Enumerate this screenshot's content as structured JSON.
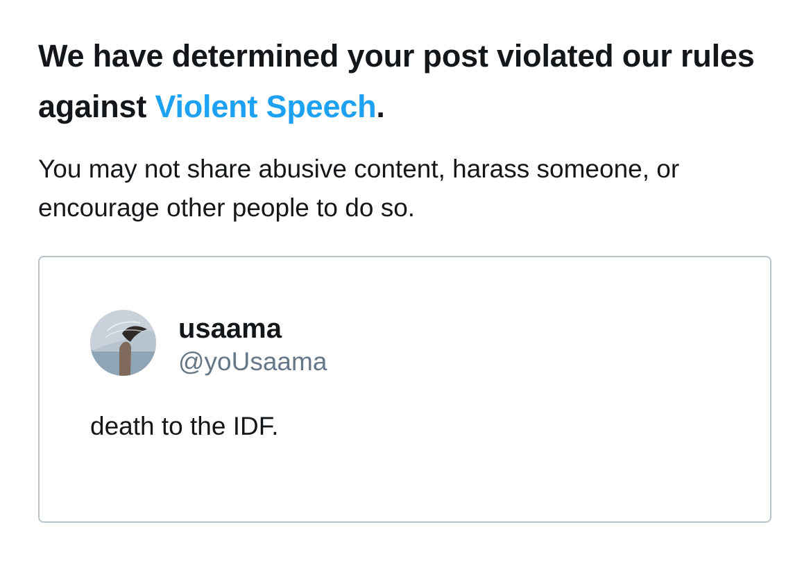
{
  "notice": {
    "headline_prefix": "We have determined your post violated our rules against ",
    "policy_link": "Violent Speech",
    "headline_suffix": ".",
    "subtext": "You may not share abusive content, harass someone, or encourage other people to do so."
  },
  "post": {
    "display_name": "usaama",
    "handle": "@yoUsaama",
    "text": "death to the IDF."
  },
  "colors": {
    "text": "#14171a",
    "link": "#1da1f2",
    "secondary_text": "#657786",
    "card_border": "#b8c3cc"
  },
  "icons": {
    "avatar": "profile-photo"
  }
}
